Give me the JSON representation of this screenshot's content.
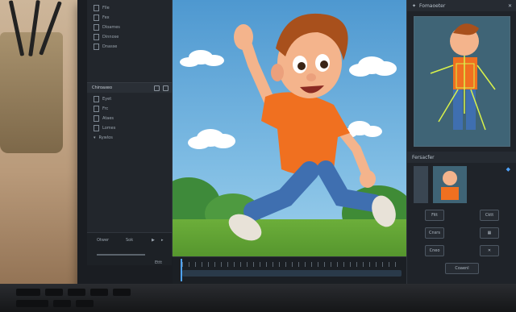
{
  "files": [
    "Flle",
    "Fex",
    "Dloames",
    "Dinnose",
    "Dnasse"
  ],
  "layers_panel": {
    "title": "Chiroaxeo",
    "items": [
      "Eyet",
      "Frc",
      "Ataes",
      "Lomes",
      "Rywlos"
    ]
  },
  "left_bottom": {
    "a": "Otwer",
    "b": "Sok"
  },
  "right_panel": {
    "title": "Fomaoeter",
    "section": "Fersacfer",
    "buttons": [
      "Fitt",
      "Cktt",
      "Cnsrs",
      "Cneo",
      "Coaenl"
    ]
  },
  "timeline": {
    "label": "Ettt"
  }
}
